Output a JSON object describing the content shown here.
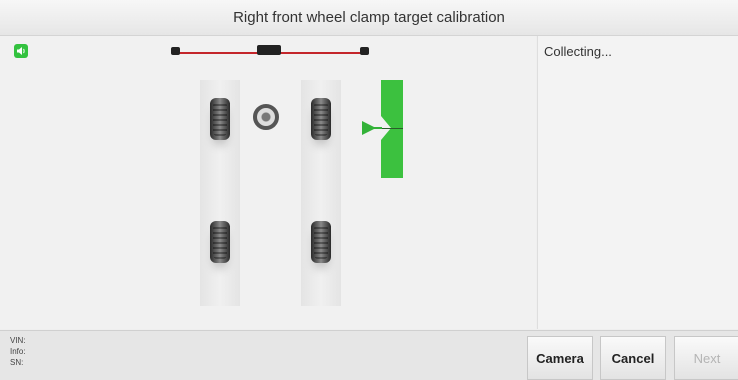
{
  "window": {
    "title": "Right front wheel clamp target calibration"
  },
  "side_panel": {
    "status": "Collecting..."
  },
  "footer": {
    "vin_label": "VIN:",
    "info_label": "Info:",
    "sn_label": "SN:"
  },
  "buttons": {
    "camera": "Camera",
    "cancel": "Cancel",
    "next": "Next"
  },
  "icons": {
    "speaker": "speaker-icon",
    "steering": "steering-wheel-icon",
    "target": "target-indicator-icon"
  },
  "colors": {
    "accent_green": "#3cc13f",
    "bar_red": "#c4262b"
  }
}
